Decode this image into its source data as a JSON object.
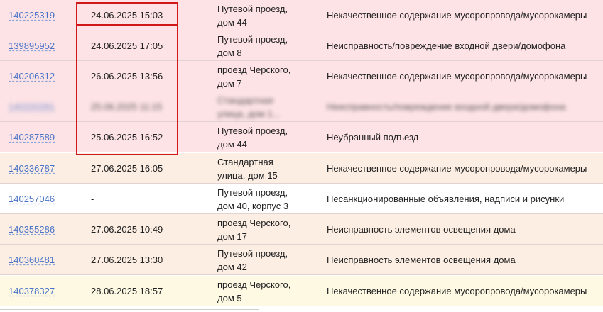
{
  "rows": [
    {
      "id": "140225319",
      "date": "24.06.2025 15:03",
      "addr1": "Путевой проезд,",
      "addr2": "дом 44",
      "desc": "Некачественное содержание мусоропровода/мусорокамеры",
      "color": "pink"
    },
    {
      "id": "139895952",
      "date": "24.06.2025 17:05",
      "addr1": "Путевой проезд,",
      "addr2": "дом 8",
      "desc": "Неисправность/повреждение входной двери/домофона",
      "color": "pink"
    },
    {
      "id": "140206312",
      "date": "26.06.2025 13:56",
      "addr1": "проезд Черского,",
      "addr2": "дом 7",
      "desc": "Некачественное содержание мусоропровода/мусорокамеры",
      "color": "pink"
    },
    {
      "id": "140220281",
      "date": "25.06.2025 11:15",
      "addr1": "Стандартная",
      "addr2": "улица, дом 1...",
      "desc": "Неисправность/повреждение входной двери/домофона",
      "color": "pink",
      "blurred": true
    },
    {
      "id": "140287589",
      "date": "25.06.2025 16:52",
      "addr1": "Путевой проезд,",
      "addr2": "дом 44",
      "desc": "Неубранный подъезд",
      "color": "pink"
    },
    {
      "id": "140336787",
      "date": "27.06.2025 16:05",
      "addr1": "Стандартная",
      "addr2": "улица, дом 15",
      "desc": "Некачественное содержание мусоропровода/мусорокамеры",
      "color": "peach"
    },
    {
      "id": "140257046",
      "date": "-",
      "addr1": "Путевой проезд,",
      "addr2": "дом 40, корпус 3",
      "desc": "Несанкционированные объявления, надписи и рисунки",
      "color": "white"
    },
    {
      "id": "140355286",
      "date": "27.06.2025 10:49",
      "addr1": "проезд Черского,",
      "addr2": "дом 17",
      "desc": "Неисправность элементов освещения дома",
      "color": "peach"
    },
    {
      "id": "140360481",
      "date": "27.06.2025 13:30",
      "addr1": "Путевой проезд,",
      "addr2": "дом 42",
      "desc": "Неисправность элементов освещения дома",
      "color": "peach"
    },
    {
      "id": "140378327",
      "date": "28.06.2025 18:57",
      "addr1": "проезд Черского,",
      "addr2": "дом 5",
      "desc": "Некачественное содержание мусоропровода/мусорокамеры",
      "color": "yellow"
    }
  ],
  "colors": {
    "pink": "#fde3e6",
    "peach": "#fdeee3",
    "white": "#ffffff",
    "yellow": "#fdf9e3",
    "link": "#4a73c7",
    "highlight": "#d01818"
  }
}
